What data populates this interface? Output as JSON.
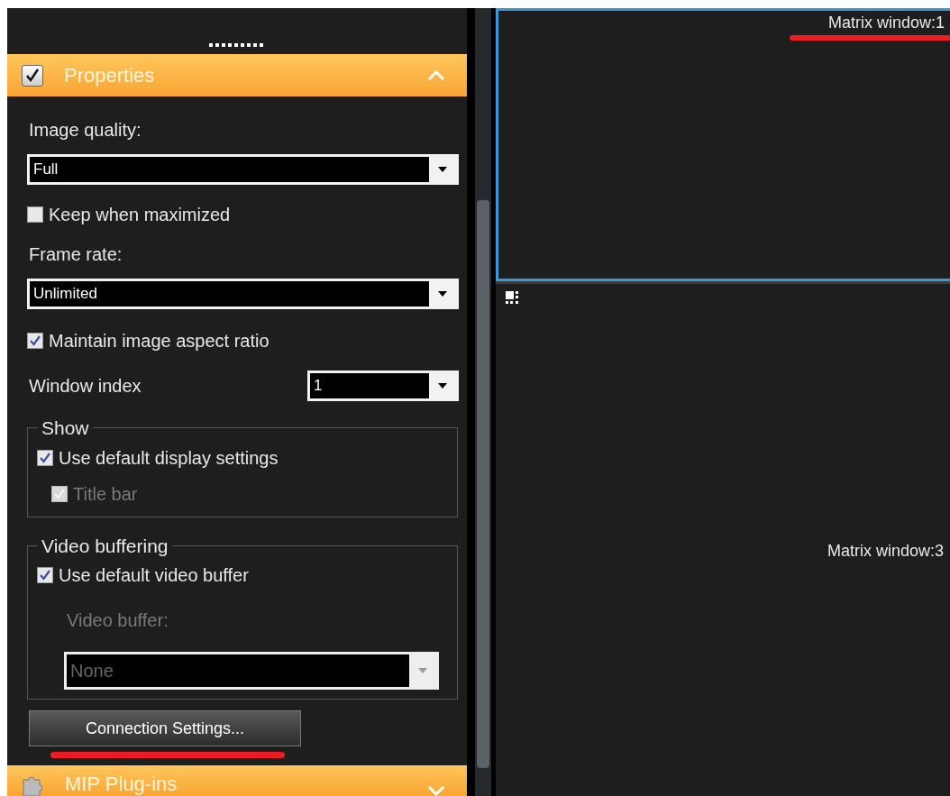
{
  "properties_header": {
    "title": "Properties",
    "checked": true,
    "expanded": true
  },
  "controls": [
    {
      "kind": "label",
      "text": "Image quality:"
    },
    {
      "kind": "dropdown",
      "value": "Full",
      "disabled": false
    },
    {
      "kind": "checkbox",
      "label": "Keep when maximized",
      "checked": false,
      "disabled": false
    },
    {
      "kind": "label",
      "text": "Frame rate:"
    },
    {
      "kind": "dropdown",
      "value": "Unlimited",
      "disabled": false
    },
    {
      "kind": "checkbox",
      "label": "Maintain image aspect ratio",
      "checked": true,
      "disabled": false
    },
    {
      "kind": "inline-dropdown",
      "label": "Window index",
      "value": "1"
    }
  ],
  "groups": [
    {
      "title": "Show",
      "items": [
        {
          "kind": "checkbox",
          "label": "Use default display settings",
          "checked": true,
          "disabled": false,
          "indent": false
        },
        {
          "kind": "checkbox",
          "label": "Title bar",
          "checked": true,
          "disabled": true,
          "indent": true
        }
      ]
    },
    {
      "title": "Video buffering",
      "items": [
        {
          "kind": "checkbox",
          "label": "Use default video buffer",
          "checked": true,
          "disabled": false,
          "indent": false
        },
        {
          "kind": "label",
          "text": "Video buffer:",
          "disabled": true
        },
        {
          "kind": "dropdown",
          "value": "None",
          "disabled": true
        }
      ]
    }
  ],
  "button": {
    "label": "Connection Settings..."
  },
  "plugins_header": {
    "title": "MIP Plug-ins",
    "expanded": false
  },
  "matrix_windows": [
    {
      "title": "Matrix window:1",
      "selected": true
    },
    {
      "title": "Matrix window:3",
      "selected": false
    }
  ]
}
